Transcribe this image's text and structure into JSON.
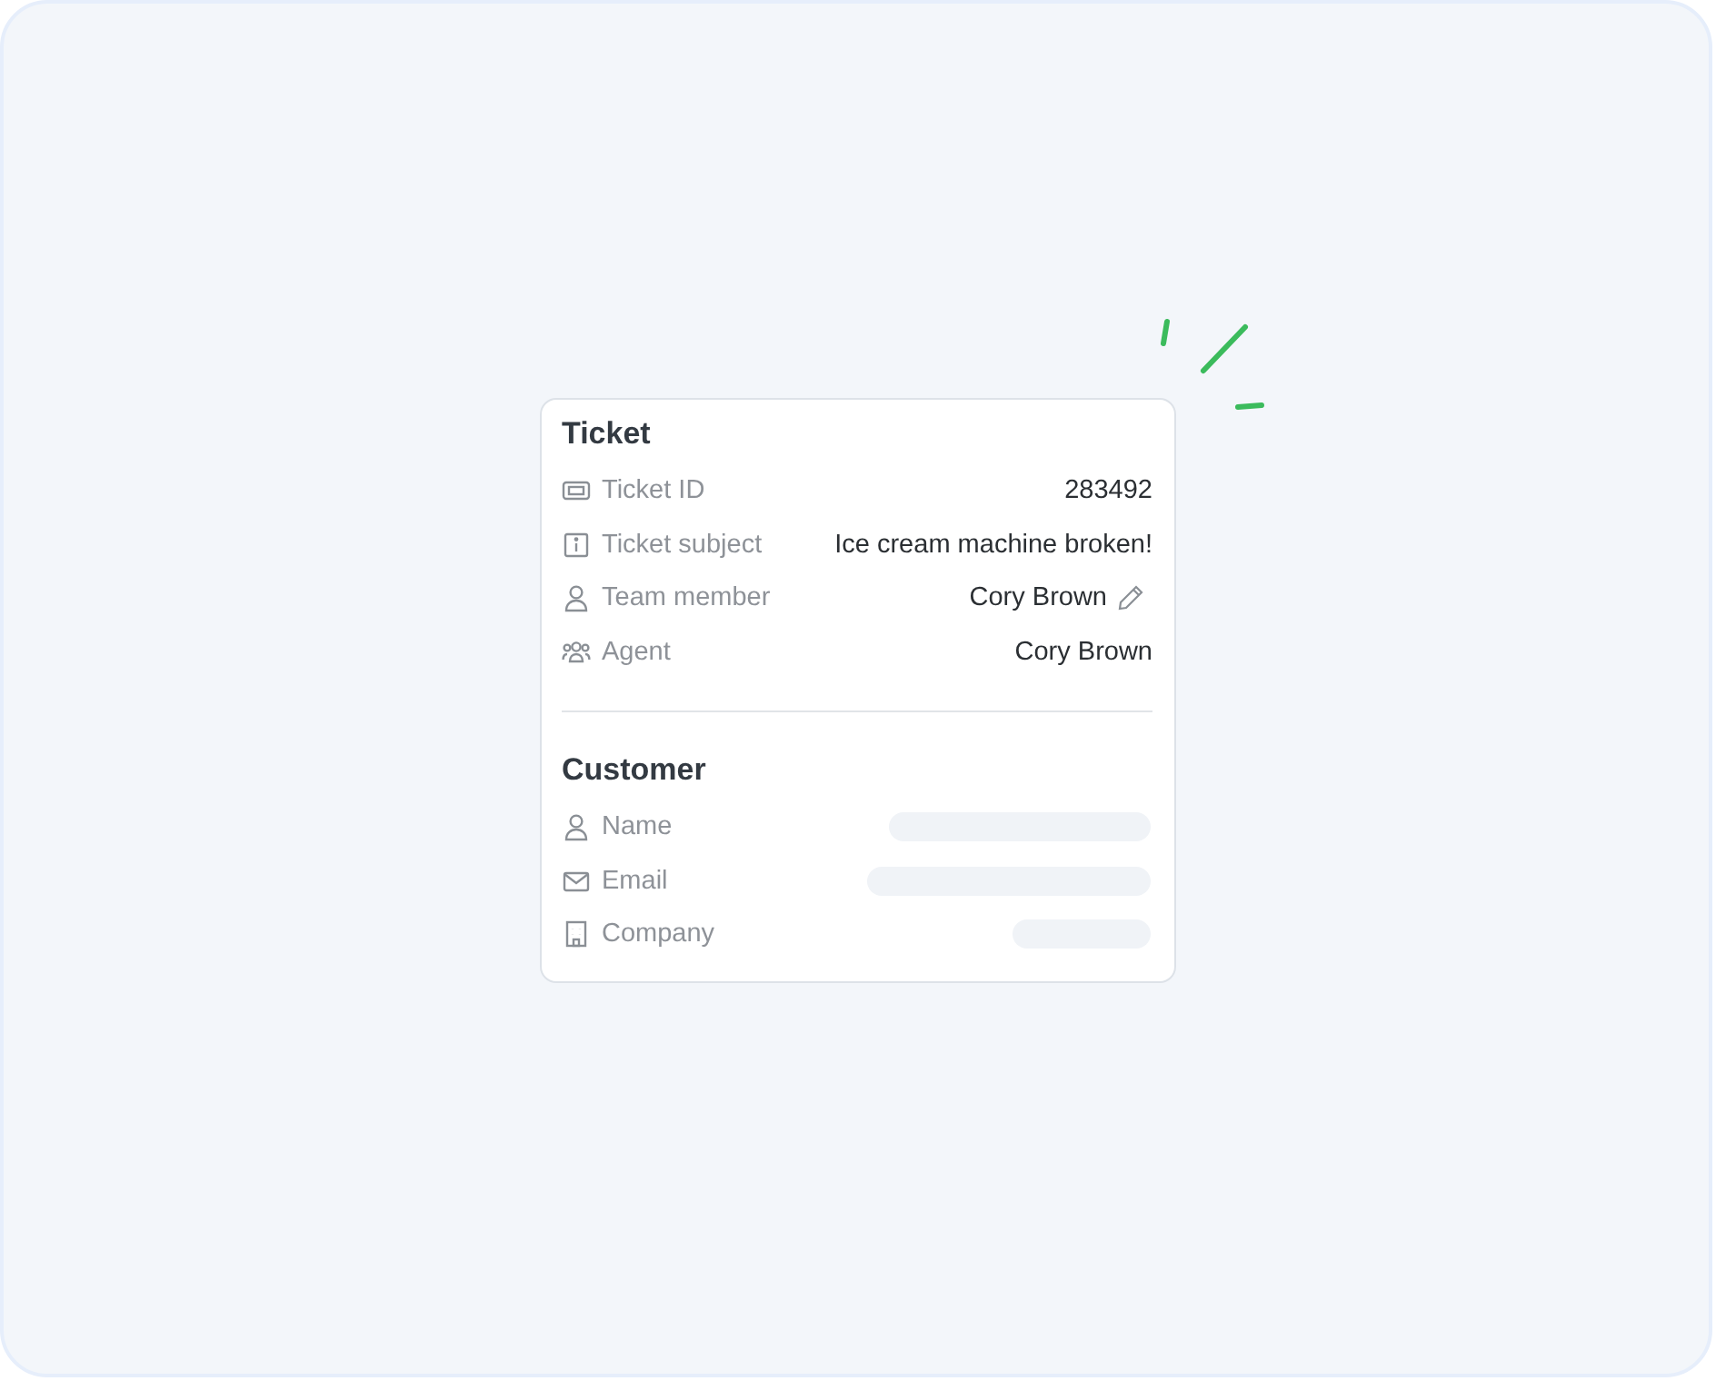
{
  "sections": [
    {
      "title": "Ticket",
      "rows": [
        {
          "label": "Ticket ID",
          "kind": "text",
          "value": "283492",
          "editable": false
        },
        {
          "label": "Ticket subject",
          "kind": "text",
          "value": "Ice cream machine broken!",
          "editable": false
        },
        {
          "label": "Team member",
          "kind": "text",
          "value": "Cory Brown",
          "editable": true
        },
        {
          "label": "Agent",
          "kind": "text",
          "value": "Cory Brown",
          "editable": false
        }
      ]
    },
    {
      "title": "Customer",
      "rows": [
        {
          "label": "Name",
          "kind": "placeholder"
        },
        {
          "label": "Email",
          "kind": "placeholder"
        },
        {
          "label": "Company",
          "kind": "placeholder"
        }
      ]
    }
  ]
}
